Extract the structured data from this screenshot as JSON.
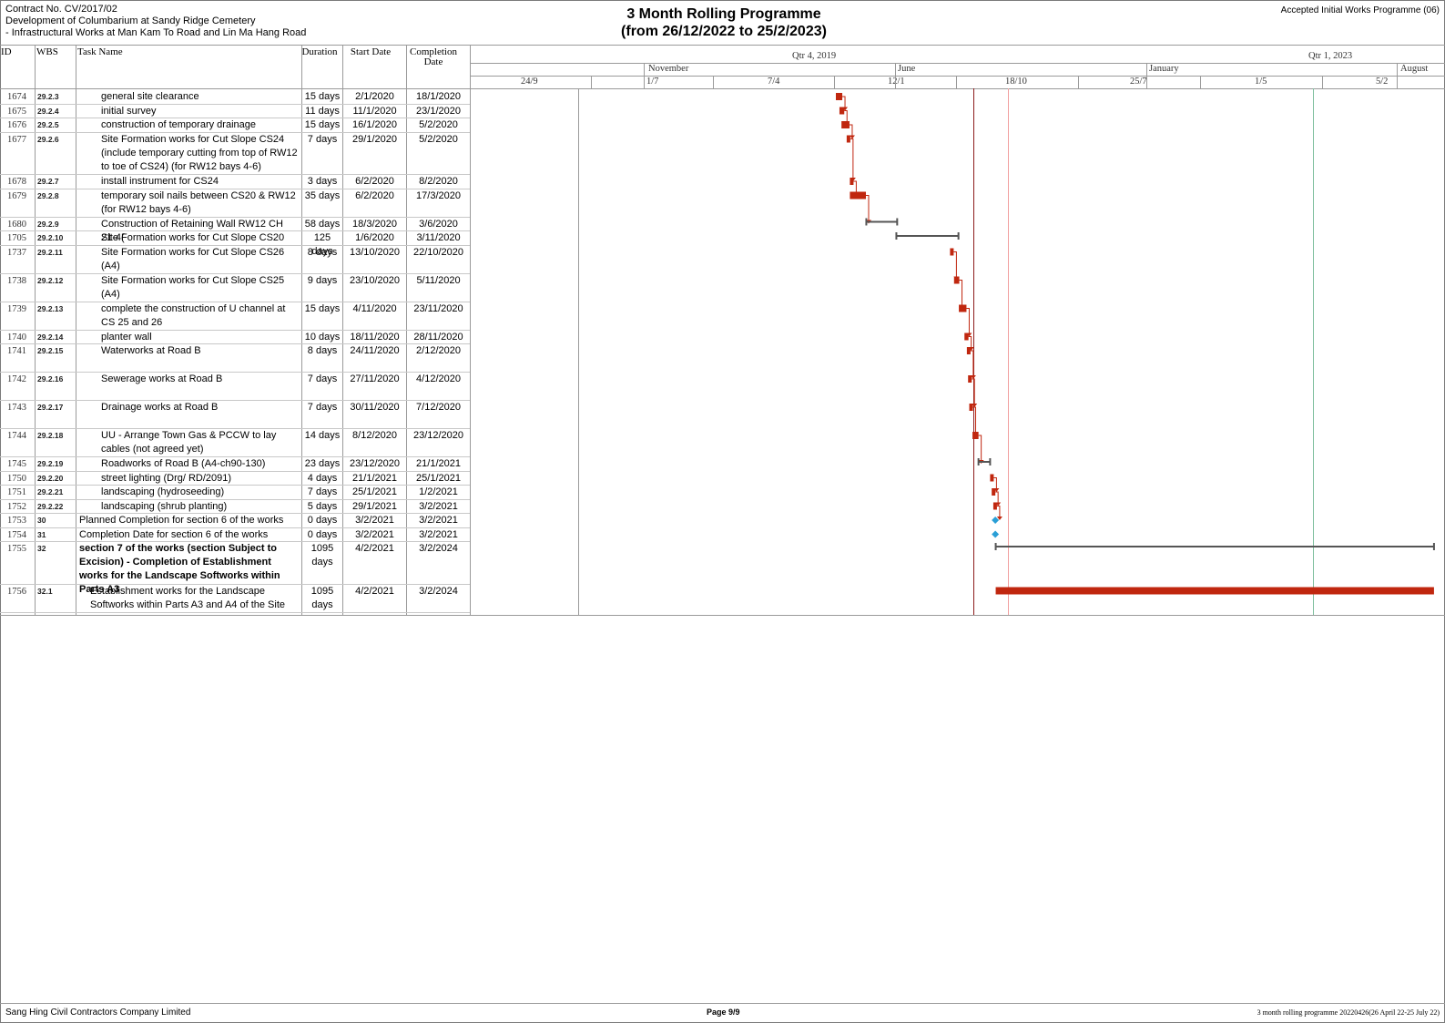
{
  "header": {
    "contract": "Contract No. CV/2017/02",
    "project_line1": "Development of Columbarium at Sandy Ridge Cemetery",
    "project_line2": "- Infrastructural Works at Man Kam To Road and Lin Ma Hang Road",
    "title_line1": "3 Month Rolling Programme",
    "title_line2": "(from 26/12/2022 to 25/2/2023)",
    "right_label": "Accepted Initial Works Programme (06)"
  },
  "columns": {
    "id": "ID",
    "wbs": "WBS",
    "task": "Task Name",
    "duration": "Duration",
    "start": "Start Date",
    "completion": "Completion Date"
  },
  "timescale": {
    "top": [
      "Qtr 4, 2019",
      "Qtr 1, 2023"
    ],
    "middle": [
      "November",
      "June",
      "January",
      "August"
    ],
    "bottom": [
      "24/9",
      "1/7",
      "7/4",
      "12/1",
      "18/10",
      "25/7",
      "1/5",
      "5/2"
    ]
  },
  "tasks": [
    {
      "id": "1674",
      "wbs": "29.2.3",
      "name": "general site clearance",
      "duration": "15 days",
      "start": "2/1/2020",
      "finish": "18/1/2020",
      "indent": 2,
      "lines": 1
    },
    {
      "id": "1675",
      "wbs": "29.2.4",
      "name": "initial survey",
      "duration": "11 days",
      "start": "11/1/2020",
      "finish": "23/1/2020",
      "indent": 2,
      "lines": 1
    },
    {
      "id": "1676",
      "wbs": "29.2.5",
      "name": "construction of temporary drainage",
      "duration": "15 days",
      "start": "16/1/2020",
      "finish": "5/2/2020",
      "indent": 2,
      "lines": 1
    },
    {
      "id": "1677",
      "wbs": "29.2.6",
      "name": "Site Formation works for Cut Slope CS24 (include temporary cutting from top of RW12 to toe of CS24) (for RW12 bays 4-6)",
      "duration": "7 days",
      "start": "29/1/2020",
      "finish": "5/2/2020",
      "indent": 2,
      "lines": 3
    },
    {
      "id": "1678",
      "wbs": "29.2.7",
      "name": "install instrument for CS24",
      "duration": "3 days",
      "start": "6/2/2020",
      "finish": "8/2/2020",
      "indent": 2,
      "lines": 1
    },
    {
      "id": "1679",
      "wbs": "29.2.8",
      "name": "temporary soil nails between CS20 & RW12 (for RW12 bays 4-6)",
      "duration": "35 days",
      "start": "6/2/2020",
      "finish": "17/3/2020",
      "indent": 2,
      "lines": 2
    },
    {
      "id": "1680",
      "wbs": "29.2.9",
      "name": "Construction of Retaining Wall RW12 CH 21-4(",
      "duration": "58 days",
      "start": "18/3/2020",
      "finish": "3/6/2020",
      "indent": 2,
      "lines": 1
    },
    {
      "id": "1705",
      "wbs": "29.2.10",
      "name": "Site Formation works for Cut Slope CS20",
      "duration": "125 days",
      "start": "1/6/2020",
      "finish": "3/11/2020",
      "indent": 2,
      "lines": 1
    },
    {
      "id": "1737",
      "wbs": "29.2.11",
      "name": "Site Formation works for Cut Slope CS26 (A4)",
      "duration": "8 days",
      "start": "13/10/2020",
      "finish": "22/10/2020",
      "indent": 2,
      "lines": 2
    },
    {
      "id": "1738",
      "wbs": "29.2.12",
      "name": "Site Formation works for Cut Slope CS25 (A4)",
      "duration": "9 days",
      "start": "23/10/2020",
      "finish": "5/11/2020",
      "indent": 2,
      "lines": 2
    },
    {
      "id": "1739",
      "wbs": "29.2.13",
      "name": "complete the construction of U channel at CS 25 and 26",
      "duration": "15 days",
      "start": "4/11/2020",
      "finish": "23/11/2020",
      "indent": 2,
      "lines": 2
    },
    {
      "id": "1740",
      "wbs": "29.2.14",
      "name": "planter wall",
      "duration": "10 days",
      "start": "18/11/2020",
      "finish": "28/11/2020",
      "indent": 2,
      "lines": 1
    },
    {
      "id": "1741",
      "wbs": "29.2.15",
      "name": "Waterworks at Road B",
      "duration": "8 days",
      "start": "24/11/2020",
      "finish": "2/12/2020",
      "indent": 2,
      "lines": 2
    },
    {
      "id": "1742",
      "wbs": "29.2.16",
      "name": "Sewerage works at Road B",
      "duration": "7 days",
      "start": "27/11/2020",
      "finish": "4/12/2020",
      "indent": 2,
      "lines": 2
    },
    {
      "id": "1743",
      "wbs": "29.2.17",
      "name": "Drainage works at Road B",
      "duration": "7 days",
      "start": "30/11/2020",
      "finish": "7/12/2020",
      "indent": 2,
      "lines": 2
    },
    {
      "id": "1744",
      "wbs": "29.2.18",
      "name": "UU - Arrange Town Gas & PCCW to lay cables (not agreed yet)",
      "duration": "14 days",
      "start": "8/12/2020",
      "finish": "23/12/2020",
      "indent": 2,
      "lines": 2
    },
    {
      "id": "1745",
      "wbs": "29.2.19",
      "name": "Roadworks of Road B (A4-ch90-130)",
      "duration": "23 days",
      "start": "23/12/2020",
      "finish": "21/1/2021",
      "indent": 2,
      "lines": 1
    },
    {
      "id": "1750",
      "wbs": "29.2.20",
      "name": "street lighting (Drg/ RD/2091)",
      "duration": "4 days",
      "start": "21/1/2021",
      "finish": "25/1/2021",
      "indent": 2,
      "lines": 1
    },
    {
      "id": "1751",
      "wbs": "29.2.21",
      "name": "landscaping (hydroseeding)",
      "duration": "7 days",
      "start": "25/1/2021",
      "finish": "1/2/2021",
      "indent": 2,
      "lines": 1
    },
    {
      "id": "1752",
      "wbs": "29.2.22",
      "name": "landscaping (shrub planting)",
      "duration": "5 days",
      "start": "29/1/2021",
      "finish": "3/2/2021",
      "indent": 2,
      "lines": 1
    },
    {
      "id": "1753",
      "wbs": "30",
      "name": "Planned Completion for section 6 of the works",
      "duration": "0 days",
      "start": "3/2/2021",
      "finish": "3/2/2021",
      "indent": 0,
      "lines": 1
    },
    {
      "id": "1754",
      "wbs": "31",
      "name": "Completion Date for section 6 of the works",
      "duration": "0 days",
      "start": "3/2/2021",
      "finish": "3/2/2021",
      "indent": 0,
      "lines": 1
    },
    {
      "id": "1755",
      "wbs": "32",
      "name": "section 7 of the works (section Subject to Excision) - Completion of Establishment works for the Landscape Softworks within Parts A3",
      "duration": "1095 days",
      "start": "4/2/2021",
      "finish": "3/2/2024",
      "indent": 0,
      "lines": 3,
      "bold": true
    },
    {
      "id": "1756",
      "wbs": "32.1",
      "name": "Establishment works for the Landscape Softworks within Parts A3 and A4 of the Site",
      "duration": "1095 days",
      "start": "4/2/2021",
      "finish": "3/2/2024",
      "indent": 1,
      "lines": 2
    }
  ],
  "colors": {
    "task_bar": "#c0270f",
    "summary_bar": "#555555",
    "milestone": "#2a9fd6",
    "status_line": "#8b1a1a",
    "pink_line": "#f2a0a0",
    "green_line": "#7fbf9f"
  },
  "footer": {
    "company": "Sang Hing Civil Contractors Company Limited",
    "page": "Page 9/9",
    "file": "3 month rolling programme 20220426(26 April 22-25 July 22)"
  }
}
